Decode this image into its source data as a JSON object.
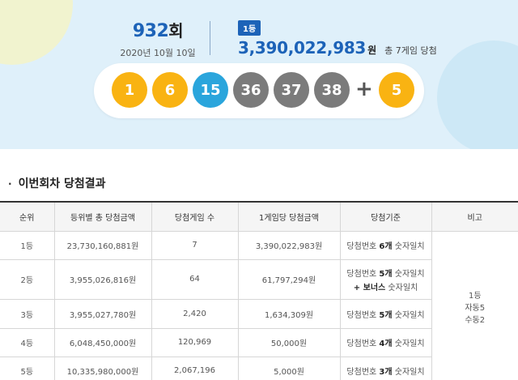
{
  "draw": {
    "round_number": "932",
    "round_suffix": "회",
    "date": "2020년 10월 10일",
    "rank_badge": "1등",
    "first_prize_amount": "3,390,022,983",
    "first_prize_unit": "원",
    "total_games_text": "총 7게임 당첨",
    "numbers": [
      {
        "value": "1",
        "color": "#f9b312"
      },
      {
        "value": "6",
        "color": "#f9b312"
      },
      {
        "value": "15",
        "color": "#2aa5dc"
      },
      {
        "value": "36",
        "color": "#7b7b7b"
      },
      {
        "value": "37",
        "color": "#7b7b7b"
      },
      {
        "value": "38",
        "color": "#7b7b7b"
      }
    ],
    "plus_symbol": "+",
    "bonus": {
      "value": "5",
      "color": "#f9b312"
    }
  },
  "results": {
    "section_title": "이번회차 당첨결과",
    "section_bullet": "·",
    "headers": [
      "순위",
      "등위별 총 당첨금액",
      "당첨게임 수",
      "1게임당 당첨금액",
      "당첨기준",
      "비고"
    ],
    "rows": [
      {
        "rank": "1등",
        "total": "23,730,160,881원",
        "games": "7",
        "per_game": "3,390,022,983원",
        "crit_pre": "당첨번호 ",
        "crit_bold": "6개",
        "crit_post": " 숫자일치",
        "crit_line2": ""
      },
      {
        "rank": "2등",
        "total": "3,955,026,816원",
        "games": "64",
        "per_game": "61,797,294원",
        "crit_pre": "당첨번호 ",
        "crit_bold": "5개",
        "crit_post": " 숫자일치",
        "crit_line2_bold": "+ 보너스",
        "crit_line2": " 숫자일치"
      },
      {
        "rank": "3등",
        "total": "3,955,027,780원",
        "games": "2,420",
        "per_game": "1,634,309원",
        "crit_pre": "당첨번호 ",
        "crit_bold": "5개",
        "crit_post": " 숫자일치",
        "crit_line2": ""
      },
      {
        "rank": "4등",
        "total": "6,048,450,000원",
        "games": "120,969",
        "per_game": "50,000원",
        "crit_pre": "당첨번호 ",
        "crit_bold": "4개",
        "crit_post": " 숫자일치",
        "crit_line2": ""
      },
      {
        "rank": "5등",
        "total": "10,335,980,000원",
        "games": "2,067,196",
        "per_game": "5,000원",
        "crit_pre": "당첨번호 ",
        "crit_bold": "3개",
        "crit_post": " 숫자일치",
        "crit_line2": ""
      }
    ],
    "note": [
      "1등",
      "자동5",
      "수동2"
    ]
  }
}
